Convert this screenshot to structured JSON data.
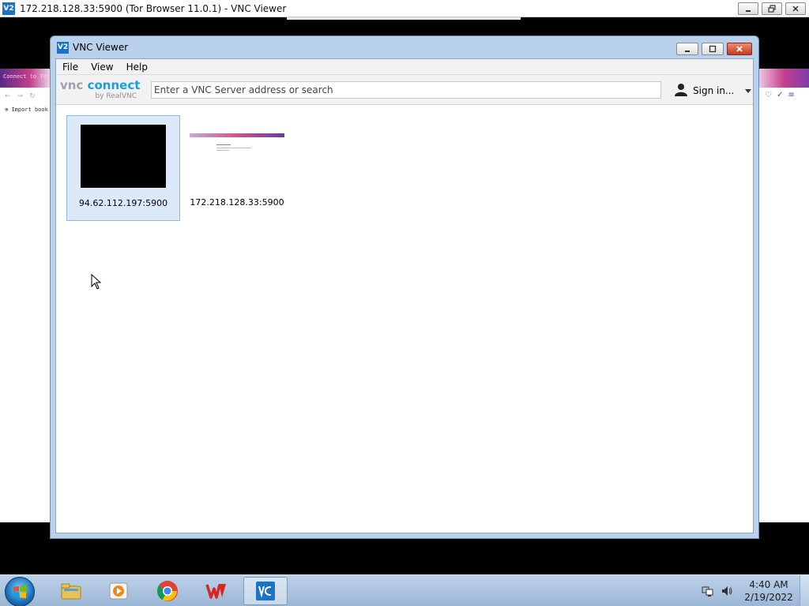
{
  "outer_window": {
    "title": "172.218.128.33:5900 (Tor Browser 11.0.1) - VNC Viewer",
    "logo_text": "V2",
    "icons": [
      "minimize-icon",
      "maximize-icon",
      "close-icon"
    ]
  },
  "remote_background": {
    "tab_text": "Connect to Tor",
    "bookmark_text": "Import book"
  },
  "vnc_window": {
    "title": "VNC Viewer",
    "logo_text": "V2",
    "menu": [
      "File",
      "View",
      "Help"
    ],
    "brand": {
      "vnc": "vnc",
      "connect": "connect",
      "by": "by RealVNC"
    },
    "search": {
      "placeholder": "Enter a VNC Server address or search",
      "value": ""
    },
    "signin_label": "Sign in...",
    "connections": [
      {
        "label": "94.62.112.197:5900",
        "selected": true,
        "thumbnail": "black-screen"
      },
      {
        "label": "172.218.128.33:5900",
        "selected": false,
        "thumbnail": "tor-browser"
      }
    ]
  },
  "taskbar": {
    "pinned": [
      "windows-explorer-icon",
      "media-player-icon",
      "chrome-icon",
      "wps-office-icon",
      "vnc-viewer-icon"
    ],
    "active": "vnc-viewer-icon",
    "clock_time": "4:40 AM",
    "clock_date": "2/19/2022"
  },
  "colors": {
    "window_frame": "#b9d1ea",
    "selection": "#dbe9f9",
    "brand_connect": "#1ea0d6",
    "close_button": "#c53a1e"
  }
}
